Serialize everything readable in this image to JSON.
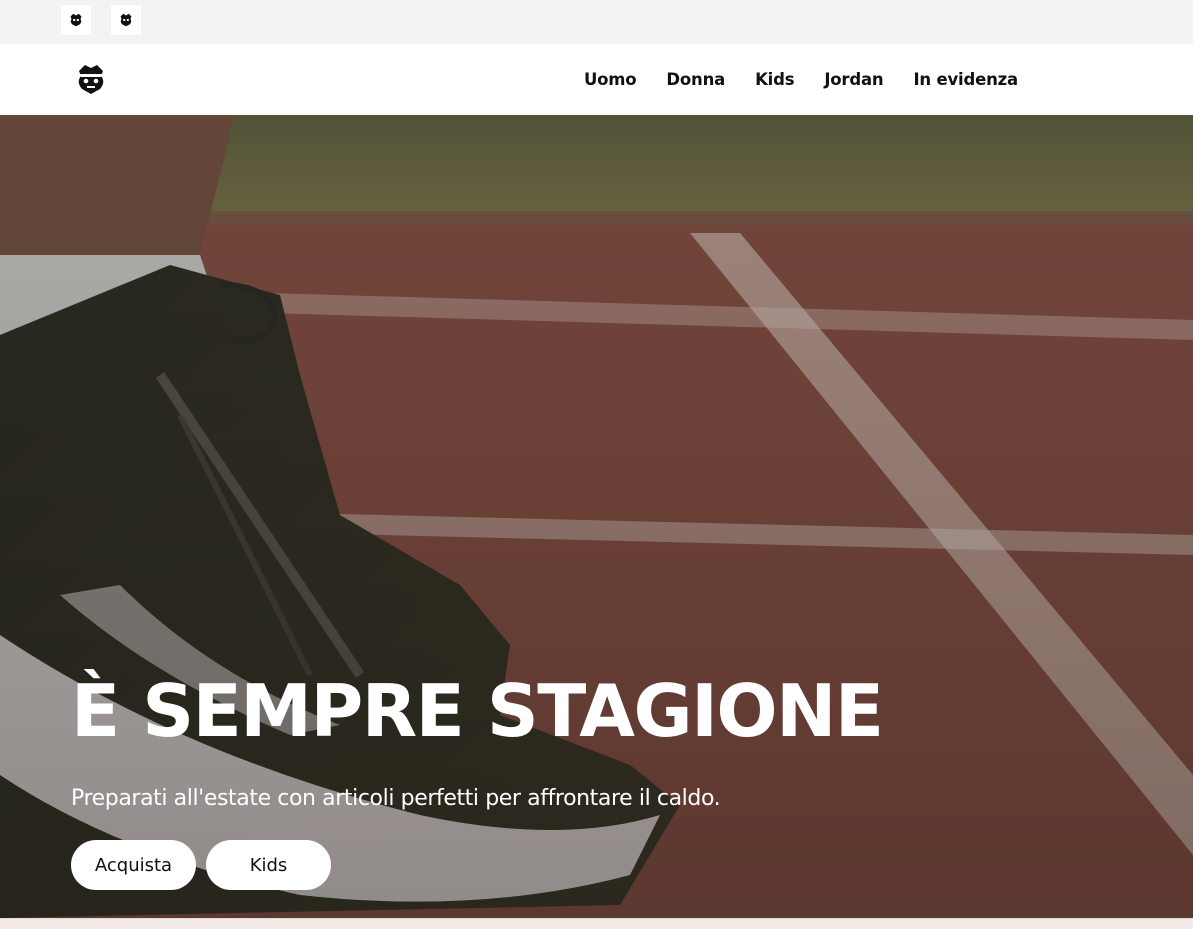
{
  "topbar": {
    "icons": [
      "brand-logo-icon",
      "brand-logo-icon"
    ]
  },
  "navbar": {
    "logo_icon": "brand-logo-icon",
    "links": [
      "Uomo",
      "Donna",
      "Kids",
      "Jordan",
      "In evidenza"
    ]
  },
  "hero": {
    "title": "È SEMPRE STAGIONE",
    "subtitle": "Preparati all'estate con articoli perfetti per affrontare il caldo.",
    "buttons": [
      "Acquista",
      "Kids"
    ]
  },
  "colors": {
    "nav_text": "#111111",
    "hero_text": "#ffffff",
    "button_bg": "#ffffff",
    "topbar_bg": "#f2f3f5",
    "track": "#7e4a3f"
  }
}
